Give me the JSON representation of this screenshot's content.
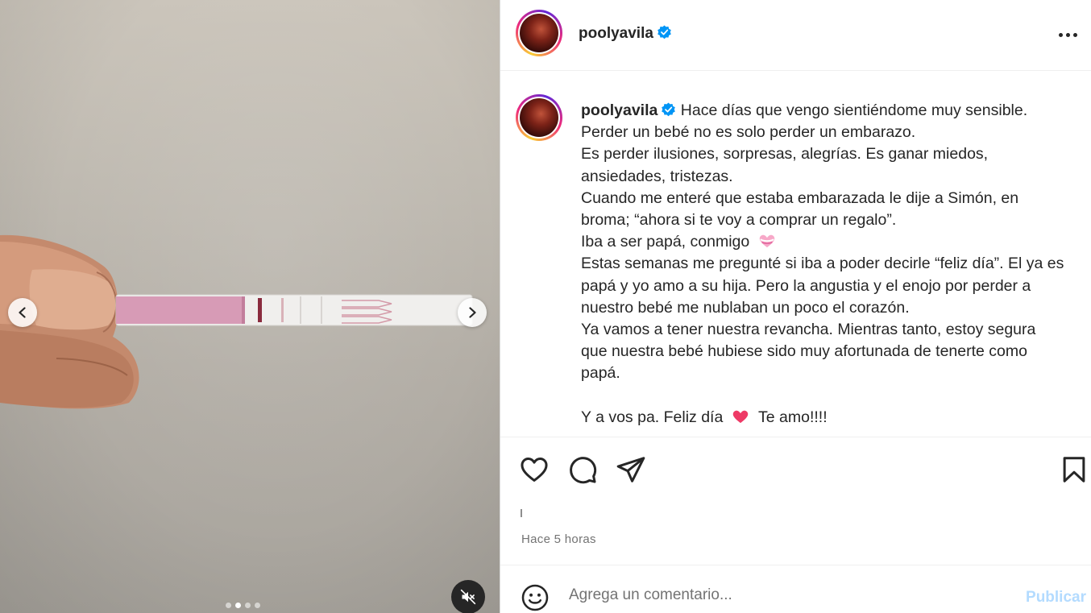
{
  "media": {
    "icons": {
      "prev": "chevron-left-icon",
      "next": "chevron-right-icon",
      "mute": "speaker-muted-icon"
    },
    "carousel": {
      "count": 4,
      "active_index": 1
    }
  },
  "post": {
    "username": "poolyavila",
    "verified_icon": "verified-badge-icon",
    "more_icon": "more-horizontal-icon",
    "caption_lines": [
      "Hace días que vengo sientiéndome muy sensible.",
      "Perder un bebé no es solo perder un embarazo.",
      "Es perder ilusiones, sorpresas, alegrías. Es ganar miedos,",
      "ansiedades, tristezas.",
      "Cuando me enteré que estaba embarazada le dije a Simón, en",
      "broma; “ahora si te voy a comprar un regalo”.",
      "Iba a ser papá, conmigo",
      "Estas semanas me pregunté si iba a poder decirle “feliz día”. El ya es",
      "papá y yo amo a su hija. Pero la angustia y el enojo por perder a",
      "nuestro bebé me nublaban un poco el corazón.",
      "Ya vamos a tener nuestra revancha. Mientras tanto, estoy segura",
      "que nuestra bebé hubiese sido muy afortunada de tenerte como",
      "papá.",
      "",
      "Y a vos pa. Feliz día",
      "Te amo!!!!"
    ],
    "emojis": {
      "pink_heart": "heart-ribbon-emoji",
      "red_heart": "red-heart-emoji"
    },
    "timestamp": "Hace 5 horas"
  },
  "actions": {
    "like_icon": "heart-icon",
    "comment_icon": "comment-icon",
    "share_icon": "paper-plane-icon",
    "save_icon": "bookmark-icon"
  },
  "comment": {
    "emoji_icon": "smiley-icon",
    "placeholder": "Agrega un comentario...",
    "publish_label": "Publicar"
  },
  "colors": {
    "text": "#262626",
    "secondary": "#737373",
    "verified": "#0095f6",
    "publish_disabled": "#b3dbff",
    "divider": "#dbdbdb"
  }
}
